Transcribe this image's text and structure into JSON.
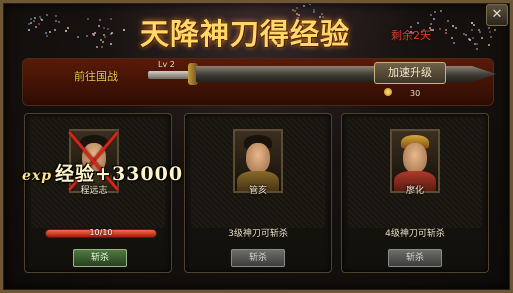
{
  "header": {
    "title": "天降神刀得经验",
    "remaining": "剩余2天",
    "close_label": "✕"
  },
  "blade_bar": {
    "go_war_label": "前往国战",
    "level": "Lv 2",
    "speedup_label": "加速升级",
    "cost": "30",
    "cost_icon": "gold-coin-icon"
  },
  "generals": [
    {
      "name": "程远志",
      "status_text": "10/10",
      "hp_fraction": 1.0,
      "defeated": true,
      "slay_label": "斩杀",
      "slay_enabled": true
    },
    {
      "name": "管亥",
      "status_text": "3级神刀可斩杀",
      "defeated": false,
      "slay_label": "斩杀",
      "slay_enabled": false
    },
    {
      "name": "廖化",
      "status_text": "4级神刀可斩杀",
      "defeated": false,
      "slay_label": "斩杀",
      "slay_enabled": false
    }
  ],
  "exp_popup": {
    "prefix": "exp",
    "text": "经验+33000"
  },
  "colors": {
    "title": "#ffd86a",
    "remaining": "#e23d2e",
    "go_war": "#f2c94c",
    "hp_bar": "#e0452c"
  }
}
